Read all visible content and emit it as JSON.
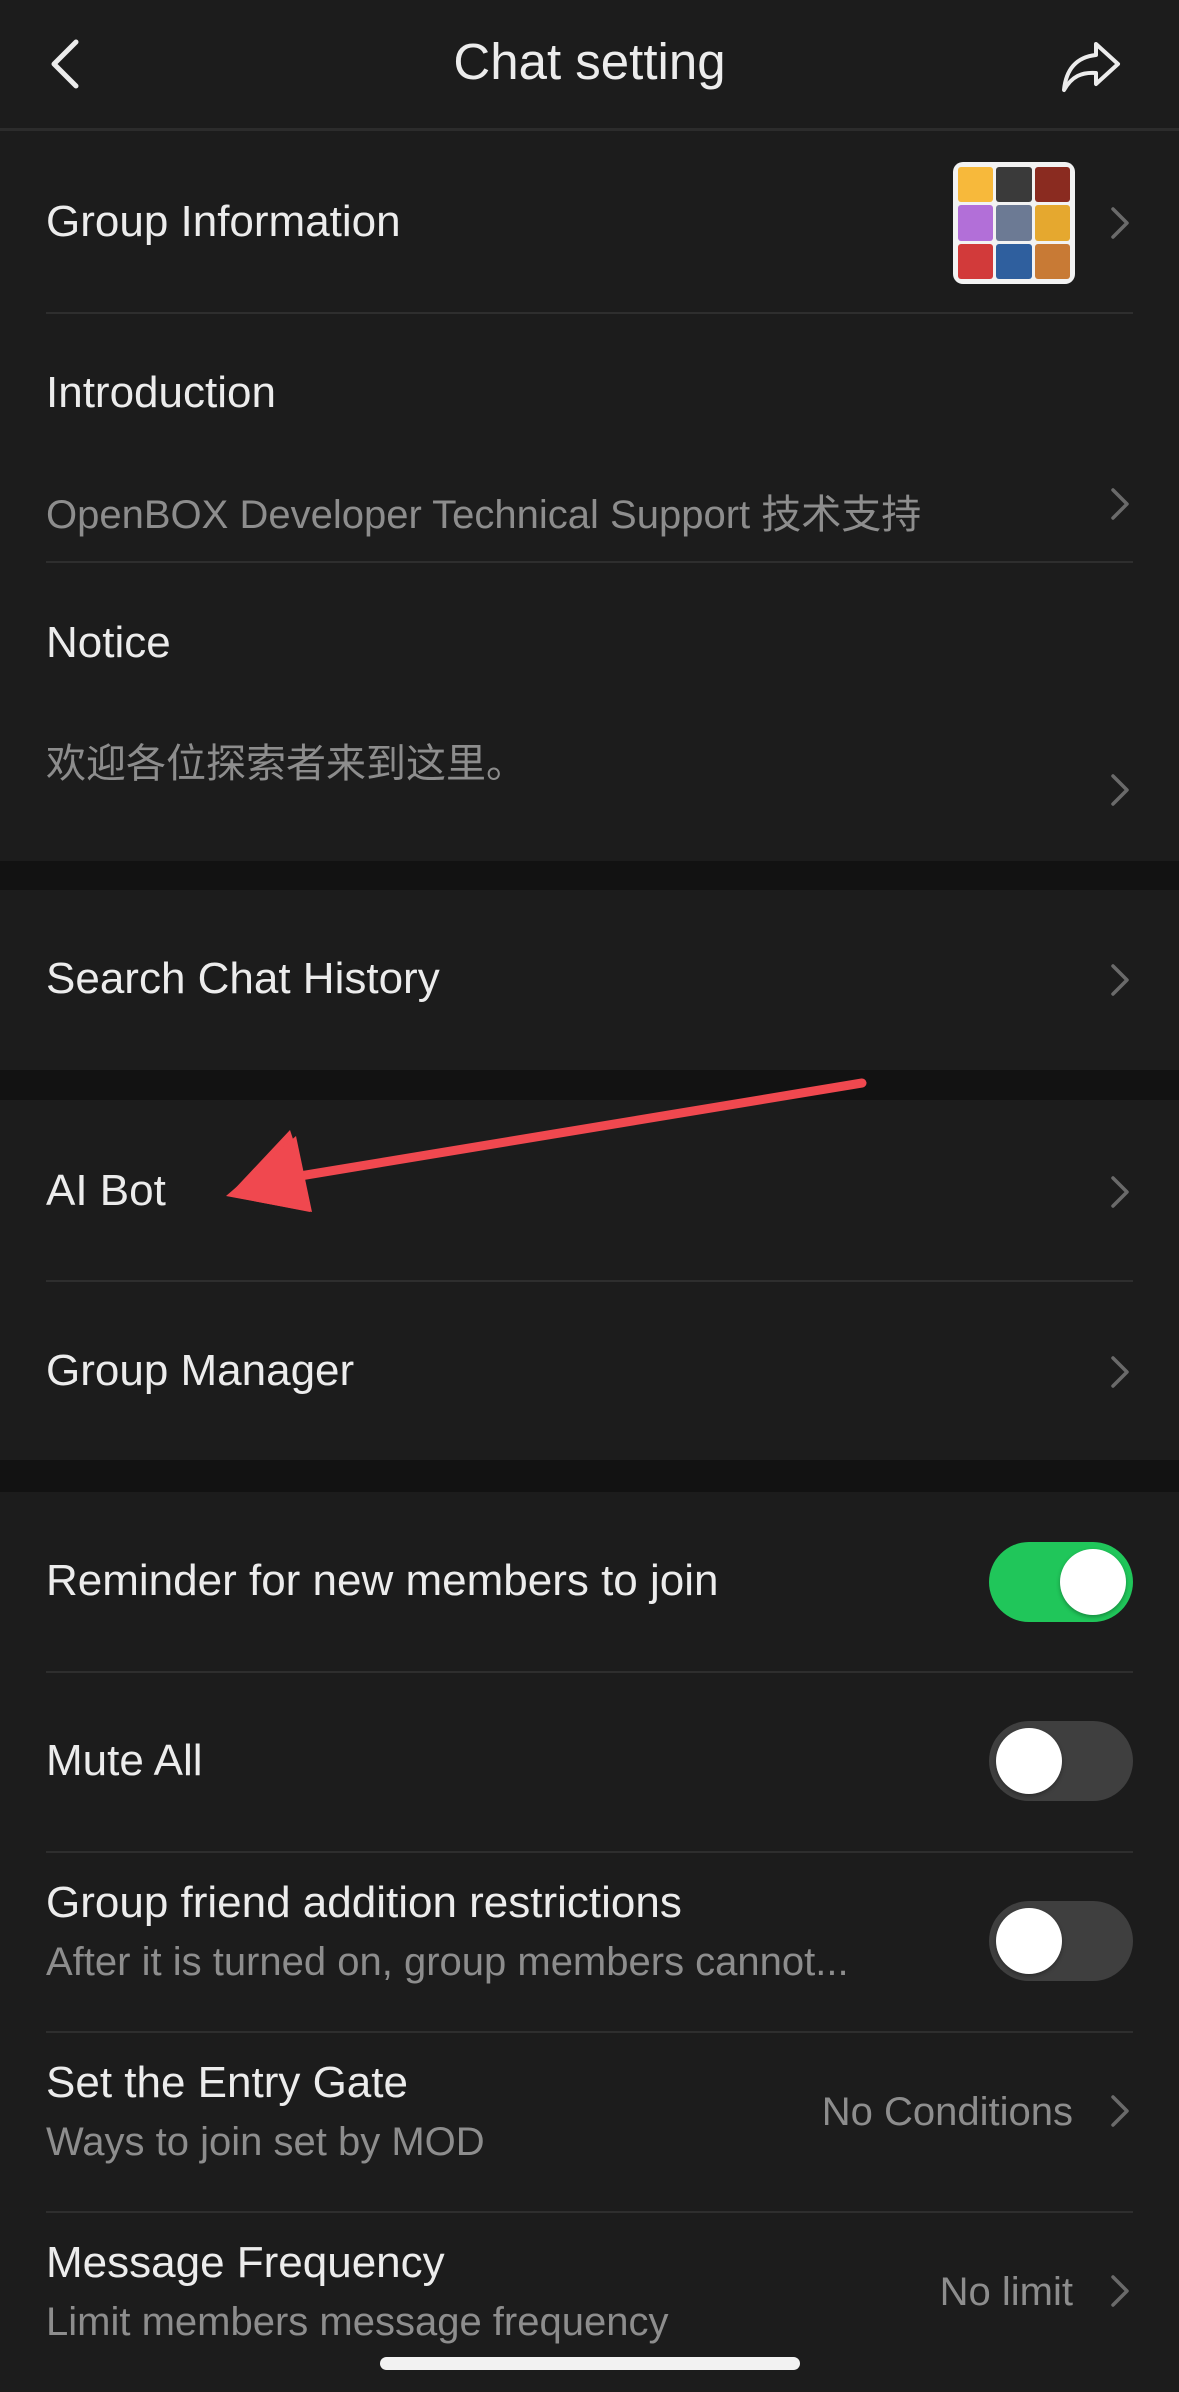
{
  "header": {
    "title": "Chat setting",
    "back_icon": "chevron-left-icon",
    "share_icon": "share-arrow-icon"
  },
  "group_info": {
    "label": "Group Information",
    "avatar": "group-avatar-collage"
  },
  "introduction": {
    "label": "Introduction",
    "text": "OpenBOX Developer Technical Support 技术支持"
  },
  "notice": {
    "label": "Notice",
    "text": "欢迎各位探索者来到这里。"
  },
  "search_history": {
    "label": "Search Chat History"
  },
  "ai_bot": {
    "label": "AI Bot",
    "annotation": "red-arrow-pointing-to-ai-bot"
  },
  "group_manager": {
    "label": "Group Manager"
  },
  "reminder": {
    "label": "Reminder for new members to join",
    "enabled": true
  },
  "mute_all": {
    "label": "Mute All",
    "enabled": false
  },
  "friend_restrictions": {
    "label": "Group friend addition restrictions",
    "sub": "After it is turned on, group members cannot...",
    "enabled": false
  },
  "entry_gate": {
    "label": "Set the Entry Gate",
    "sub": "Ways to join set by MOD",
    "value": "No Conditions"
  },
  "message_frequency": {
    "label": "Message Frequency",
    "sub": "Limit members message frequency",
    "value": "No limit"
  },
  "colors": {
    "background": "#121212",
    "panel": "#1c1c1c",
    "toggle_on": "#20c65a",
    "toggle_off": "#3f3f3f",
    "annotation_arrow": "#f0484f"
  }
}
